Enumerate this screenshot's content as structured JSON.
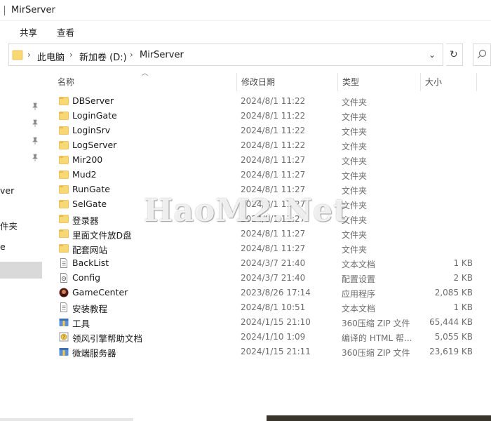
{
  "window": {
    "title": "MirServer"
  },
  "ribbon": {
    "tabs": [
      "共享",
      "查看"
    ]
  },
  "address": {
    "crumbs": [
      "此电脑",
      "新加卷 (D:)",
      "MirServer"
    ]
  },
  "nav": {
    "fragments": [
      "ver",
      "件夹",
      "e"
    ]
  },
  "columns": {
    "name": "名称",
    "date": "修改日期",
    "type": "类型",
    "size": "大小"
  },
  "watermark": "HaoM2.Net",
  "files": [
    {
      "name": "DBServer",
      "date": "2024/8/1 11:22",
      "type": "文件夹",
      "size": "",
      "icon": "folder-icon"
    },
    {
      "name": "LoginGate",
      "date": "2024/8/1 11:22",
      "type": "文件夹",
      "size": "",
      "icon": "folder-icon"
    },
    {
      "name": "LoginSrv",
      "date": "2024/8/1 11:22",
      "type": "文件夹",
      "size": "",
      "icon": "folder-icon"
    },
    {
      "name": "LogServer",
      "date": "2024/8/1 11:22",
      "type": "文件夹",
      "size": "",
      "icon": "folder-icon"
    },
    {
      "name": "Mir200",
      "date": "2024/8/1 11:27",
      "type": "文件夹",
      "size": "",
      "icon": "folder-icon"
    },
    {
      "name": "Mud2",
      "date": "2024/8/1 11:27",
      "type": "文件夹",
      "size": "",
      "icon": "folder-icon"
    },
    {
      "name": "RunGate",
      "date": "2024/8/1 11:27",
      "type": "文件夹",
      "size": "",
      "icon": "folder-icon"
    },
    {
      "name": "SelGate",
      "date": "2024/8/1 11:27",
      "type": "文件夹",
      "size": "",
      "icon": "folder-icon"
    },
    {
      "name": "登录器",
      "date": "2024/8/1 11:27",
      "type": "文件夹",
      "size": "",
      "icon": "folder-icon"
    },
    {
      "name": "里面文件放D盘",
      "date": "2024/8/1 11:27",
      "type": "文件夹",
      "size": "",
      "icon": "folder-icon"
    },
    {
      "name": "配套网站",
      "date": "2024/8/1 11:27",
      "type": "文件夹",
      "size": "",
      "icon": "folder-icon"
    },
    {
      "name": "BackList",
      "date": "2024/3/7 21:40",
      "type": "文本文档",
      "size": "1 KB",
      "icon": "text-file-icon"
    },
    {
      "name": "Config",
      "date": "2024/3/7 21:40",
      "type": "配置设置",
      "size": "2 KB",
      "icon": "config-file-icon"
    },
    {
      "name": "GameCenter",
      "date": "2023/8/26 17:14",
      "type": "应用程序",
      "size": "2,085 KB",
      "icon": "app-icon"
    },
    {
      "name": "安装教程",
      "date": "2024/8/1 10:51",
      "type": "文本文档",
      "size": "1 KB",
      "icon": "text-file-icon"
    },
    {
      "name": "工具",
      "date": "2024/1/15 21:10",
      "type": "360压缩 ZIP 文件",
      "size": "65,444 KB",
      "icon": "zip-icon"
    },
    {
      "name": "领风引擎帮助文档",
      "date": "2024/1/10 1:09",
      "type": "编译的 HTML 帮...",
      "size": "5,055 KB",
      "icon": "chm-icon"
    },
    {
      "name": "微端服务器",
      "date": "2024/1/15 21:11",
      "type": "360压缩 ZIP 文件",
      "size": "23,619 KB",
      "icon": "zip-icon"
    }
  ],
  "colors": {
    "folder": "#f8d775",
    "folder_dark": "#e9b949",
    "selected": "#d9d9d9"
  }
}
